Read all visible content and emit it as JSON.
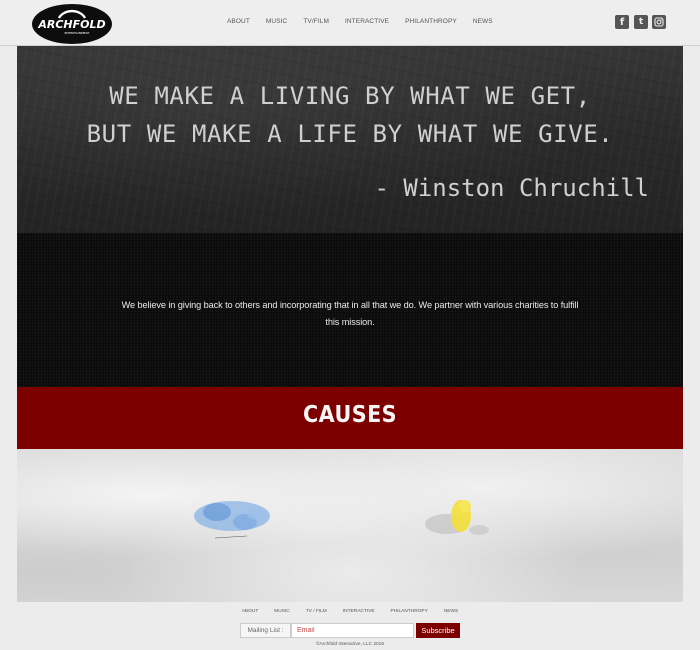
{
  "brand": {
    "logo_text": "ARCHFOLD",
    "logo_subtext": "ENTERTAINMENT"
  },
  "nav": {
    "items": [
      "ABOUT",
      "MUSIC",
      "TV/FILM",
      "INTERACTIVE",
      "PHILANTHROPY",
      "NEWS"
    ]
  },
  "social": {
    "facebook": "f",
    "twitter": "t",
    "instagram": "instagram-icon"
  },
  "hero": {
    "quote_line1": "WE MAKE A LIVING BY WHAT WE GET,",
    "quote_line2": "BUT WE MAKE A LIFE BY WHAT WE GIVE.",
    "author": "- Winston Chruchill"
  },
  "mission": {
    "text": "We believe in giving back to others and incorporating that in all that we do. We partner with various charities to fulfill this mission."
  },
  "causes": {
    "title": "CAUSES"
  },
  "footer": {
    "nav": [
      "ABOUT",
      "MUSIC",
      "TV / FILM",
      "INTERACTIVE",
      "PHILANTHROPY",
      "NEWS"
    ],
    "mailing_label": "Mailing List :",
    "email_placeholder": "Email",
    "subscribe_label": "Subscribe",
    "copyright": "©Archfold Interactive, LLC 2015"
  },
  "colors": {
    "accent": "#7d0000",
    "header_bg": "#eeeeee"
  }
}
